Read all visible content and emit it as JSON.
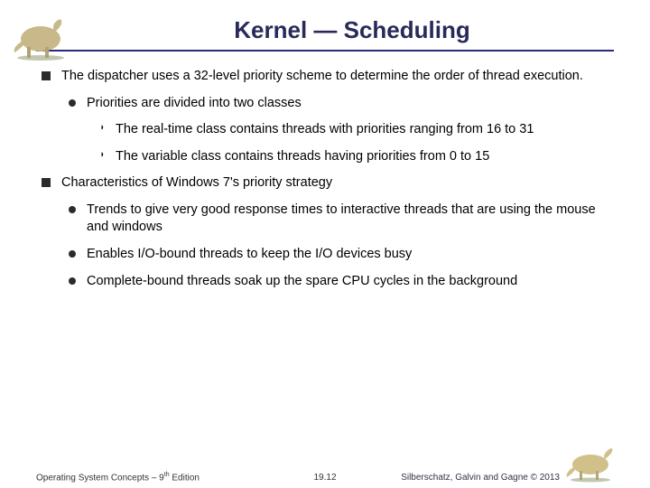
{
  "title": "Kernel — Scheduling",
  "bullets": {
    "b1": "The dispatcher uses a 32-level priority scheme to determine the order of thread execution.",
    "b1_1": "Priorities are divided into two classes",
    "b1_1_1": "The real-time class contains threads with priorities ranging from 16 to 31",
    "b1_1_2": "The variable class contains threads having priorities from 0 to 15",
    "b2": "Characteristics of Windows 7's priority strategy",
    "b2_1": "Trends to give very good response times to interactive threads that are using the mouse and windows",
    "b2_2": "Enables I/O-bound threads to keep the I/O devices busy",
    "b2_3": "Complete-bound threads soak up the spare CPU cycles in the background"
  },
  "footer": {
    "left_a": "Operating System Concepts – 9",
    "left_b": " Edition",
    "left_sup": "th",
    "center": "19.12",
    "right": "Silberschatz, Galvin and Gagne © 2013"
  }
}
